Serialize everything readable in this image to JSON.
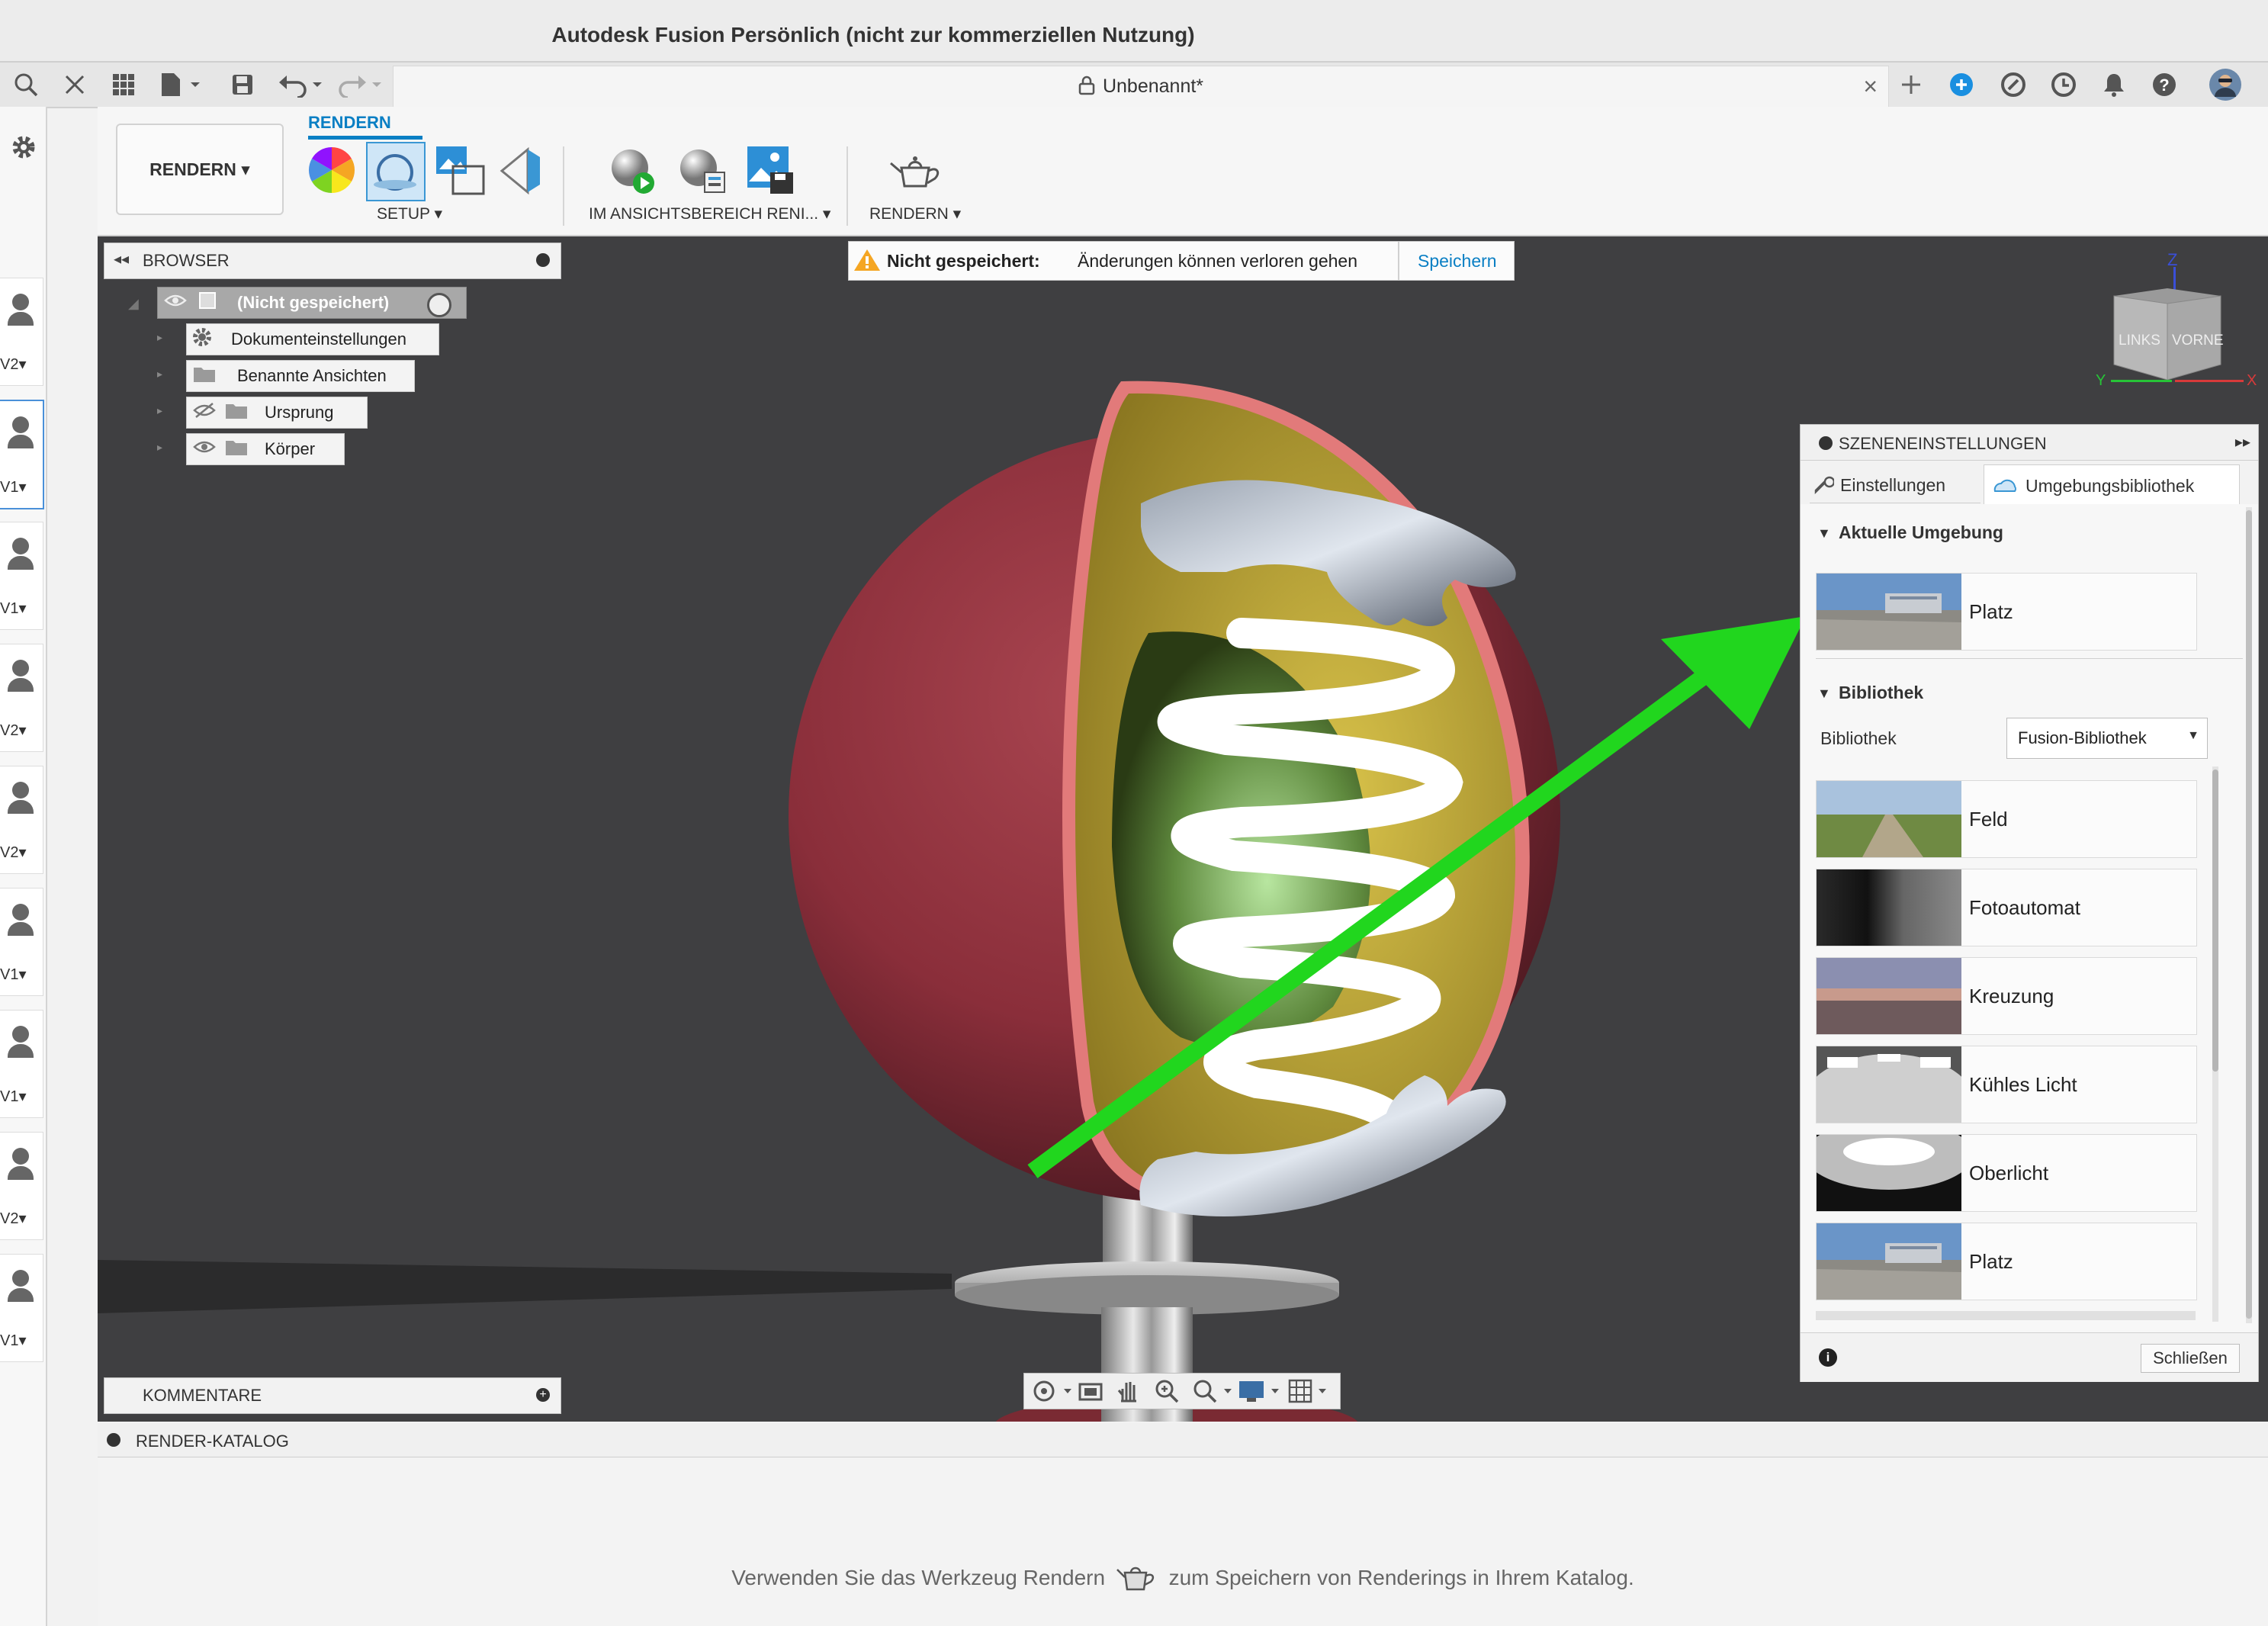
{
  "app_title": "Autodesk Fusion Persönlich (nicht zur kommerziellen Nutzung)",
  "document_tab": {
    "name": "Unbenannt*"
  },
  "ribbon": {
    "workspace": "RENDERN",
    "active_tab": "RENDERN",
    "groups": [
      {
        "label": "SETUP"
      },
      {
        "label": "IM ANSICHTSBEREICH RENI..."
      },
      {
        "label": "RENDERN"
      }
    ]
  },
  "left_strip": {
    "versions": [
      "V2",
      "V1",
      "V1",
      "V2",
      "V2",
      "V1",
      "V1",
      "V2",
      "V1"
    ]
  },
  "browser": {
    "title": "BROWSER",
    "root": "(Nicht gespeichert)",
    "items": [
      {
        "label": "Dokumenteinstellungen"
      },
      {
        "label": "Benannte Ansichten"
      },
      {
        "label": "Ursprung"
      },
      {
        "label": "Körper"
      }
    ]
  },
  "comments": {
    "title": "KOMMENTARE"
  },
  "banner": {
    "status": "Nicht gespeichert:",
    "message": "Änderungen können verloren gehen",
    "action": "Speichern"
  },
  "viewcube": {
    "z": "Z",
    "left": "LINKS",
    "front": "VORNE",
    "y": "Y",
    "x": "X"
  },
  "scene_settings": {
    "title": "SZENENEINSTELLUNGEN",
    "tabs": [
      {
        "label": "Einstellungen"
      },
      {
        "label": "Umgebungsbibliothek"
      }
    ],
    "current_section": "Aktuelle Umgebung",
    "current_env": "Platz",
    "library_section": "Bibliothek",
    "library_label": "Bibliothek",
    "library_value": "Fusion-Bibliothek",
    "environments": [
      {
        "label": "Feld"
      },
      {
        "label": "Fotoautomat"
      },
      {
        "label": "Kreuzung"
      },
      {
        "label": "Kühles Licht"
      },
      {
        "label": "Oberlicht"
      },
      {
        "label": "Platz"
      }
    ],
    "close_button": "Schließen"
  },
  "render_catalog": {
    "title": "RENDER-KATALOG",
    "hint_before": "Verwenden Sie das Werkzeug Rendern",
    "hint_after": "zum Speichern von Renderings in Ihrem Katalog."
  },
  "colors": {
    "accent": "#0a7fc4",
    "arrow": "#21d61e",
    "viewport": "#3f3f41"
  }
}
